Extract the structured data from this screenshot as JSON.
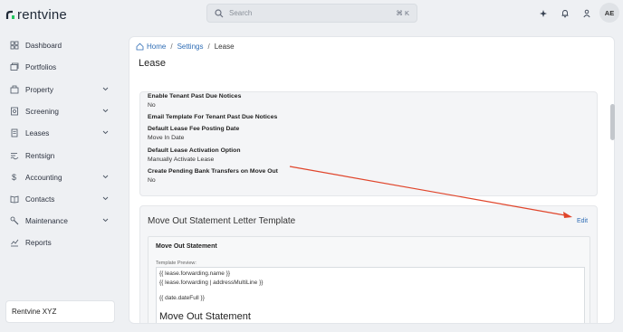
{
  "app": {
    "logo_text": "rentvine"
  },
  "search": {
    "placeholder": "Search",
    "shortcut": "⌘ K"
  },
  "user": {
    "initials": "AE"
  },
  "sidebar": {
    "items": [
      {
        "label": "Dashboard",
        "icon": "dashboard-icon",
        "has_chevron": false
      },
      {
        "label": "Portfolios",
        "icon": "portfolios-icon",
        "has_chevron": false
      },
      {
        "label": "Property",
        "icon": "property-icon",
        "has_chevron": true
      },
      {
        "label": "Screening",
        "icon": "screening-icon",
        "has_chevron": true
      },
      {
        "label": "Leases",
        "icon": "leases-icon",
        "has_chevron": true
      },
      {
        "label": "Rentsign",
        "icon": "rentsign-icon",
        "has_chevron": false
      },
      {
        "label": "Accounting",
        "icon": "dollar-icon",
        "has_chevron": true
      },
      {
        "label": "Contacts",
        "icon": "contacts-icon",
        "has_chevron": true
      },
      {
        "label": "Maintenance",
        "icon": "wrench-icon",
        "has_chevron": true
      },
      {
        "label": "Reports",
        "icon": "chart-icon",
        "has_chevron": false
      }
    ],
    "org_name": "Rentvine XYZ"
  },
  "breadcrumb": {
    "home": "Home",
    "settings": "Settings",
    "current": "Lease",
    "sep": "/"
  },
  "page": {
    "title": "Lease"
  },
  "settings_fields": [
    {
      "label": "Enable Tenant Past Due Notices",
      "value": "No"
    },
    {
      "label": "Email Template For Tenant Past Due Notices",
      "value": ""
    },
    {
      "label": "Default Lease Fee Posting Date",
      "value": "Move In Date"
    },
    {
      "label": "Default Lease Activation Option",
      "value": "Manually Activate Lease"
    },
    {
      "label": "Create Pending Bank Transfers on Move Out",
      "value": "No"
    }
  ],
  "template_card": {
    "title": "Move Out Statement Letter Template",
    "edit_label": "Edit",
    "inner_title": "Move Out Statement",
    "preview_label": "Template Preview:",
    "preview_lines": [
      "{{ lease.forwarding.name }}",
      "{{ lease.forwarding | addressMultiLine }}",
      "{{ date.dateFull }}"
    ],
    "preview_heading": "Move Out Statement"
  },
  "colors": {
    "accent": "#2f6db5",
    "annotation_arrow": "#e0452b"
  }
}
